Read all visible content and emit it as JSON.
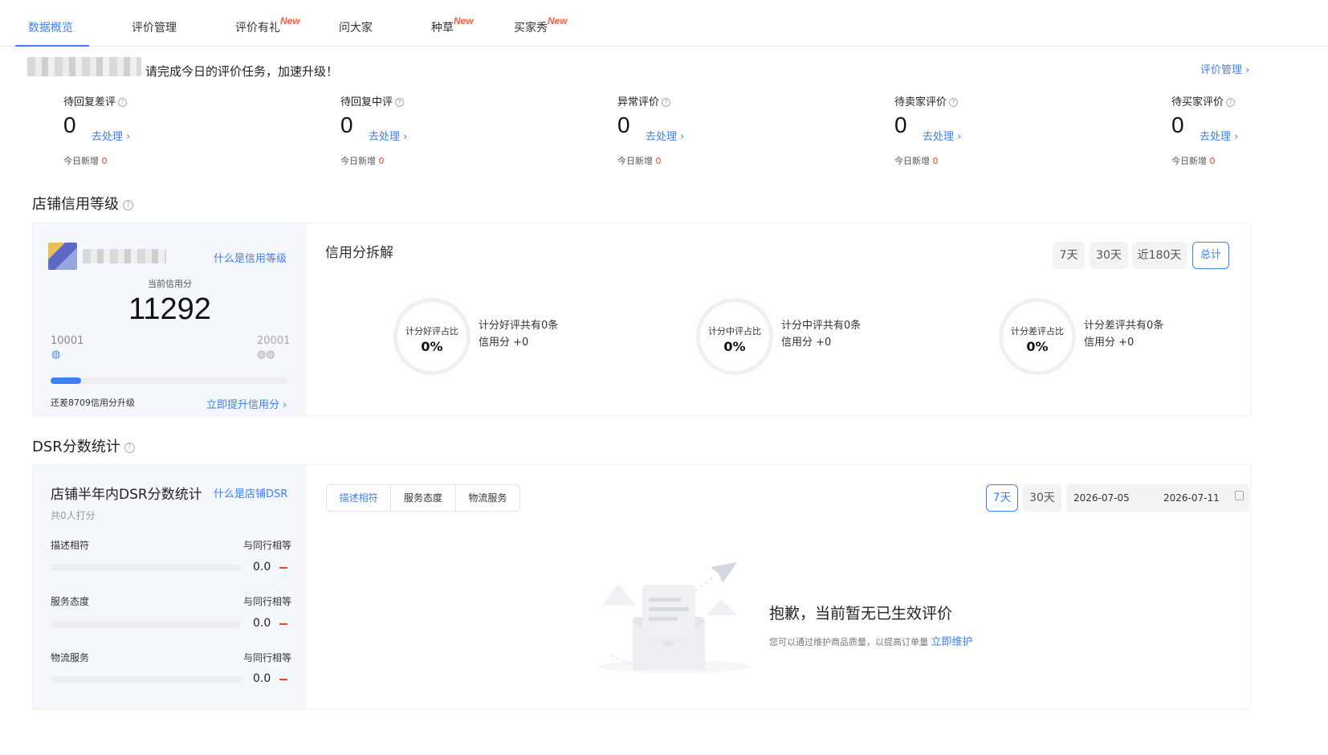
{
  "tabs": [
    {
      "label": "数据概览"
    },
    {
      "label": "评价管理"
    },
    {
      "label": "评价有礼",
      "badge": "New"
    },
    {
      "label": "问大家"
    },
    {
      "label": "种草",
      "badge": "New"
    },
    {
      "label": "买家秀",
      "badge": "New"
    }
  ],
  "notice": {
    "text": "请完成今日的评价任务，加速升级！",
    "manage_link": "评价管理 ›"
  },
  "stats": [
    {
      "title": "待回复差评",
      "value": "0",
      "action": "去处理 ›",
      "today_label": "今日新增",
      "today_value": "0"
    },
    {
      "title": "待回复中评",
      "value": "0",
      "action": "去处理 ›",
      "today_label": "今日新增",
      "today_value": "0"
    },
    {
      "title": "异常评价",
      "value": "0",
      "action": "去处理 ›",
      "today_label": "今日新增",
      "today_value": "0"
    },
    {
      "title": "待卖家评价",
      "value": "0",
      "action": "去处理 ›",
      "today_label": "今日新增",
      "today_value": "0"
    },
    {
      "title": "待买家评价",
      "value": "0",
      "action": "去处理 ›",
      "today_label": "今日新增",
      "today_value": "0"
    }
  ],
  "credit": {
    "section_title": "店铺信用等级",
    "what_link": "什么是信用等级",
    "current_label": "当前信用分",
    "score": "11292",
    "min_label": "10001",
    "max_label": "20001",
    "progress": 0.13,
    "remaining_text": "还差8709信用分升级",
    "improve_link": "立即提升信用分 ›",
    "breakdown_title": "信用分拆解",
    "periods": [
      "7天",
      "30天",
      "近180天",
      "总计"
    ],
    "active_period": "总计",
    "rings": [
      {
        "label": "计分好评占比",
        "percent": "0%",
        "line1": "计分好评共有0条",
        "line2": "信用分 +0"
      },
      {
        "label": "计分中评占比",
        "percent": "0%",
        "line1": "计分中评共有0条",
        "line2": "信用分 +0"
      },
      {
        "label": "计分差评占比",
        "percent": "0%",
        "line1": "计分差评共有0条",
        "line2": "信用分 +0"
      }
    ]
  },
  "dsr": {
    "section_title": "DSR分数统计",
    "panel_title": "店铺半年内DSR分数统计",
    "what_link": "什么是店铺DSR",
    "raters": "共0人打分",
    "rows": [
      {
        "label": "描述相符",
        "compare": "与同行相等",
        "value": "0.0"
      },
      {
        "label": "服务态度",
        "compare": "与同行相等",
        "value": "0.0"
      },
      {
        "label": "物流服务",
        "compare": "与同行相等",
        "value": "0.0"
      }
    ],
    "subtabs": [
      "描述相符",
      "服务态度",
      "物流服务"
    ],
    "active_subtab": "描述相符",
    "periods": [
      "7天",
      "30天"
    ],
    "active_period": "7天",
    "date_start": "2026-07-05",
    "date_end": "2026-07-11",
    "empty_title": "抱歉，当前暂无已生效评价",
    "empty_desc": "您可以通过维护商品质量，以提高订单量",
    "empty_link": "立即维护"
  },
  "colors": {
    "accent": "#3d7ff5",
    "badge": "#ff5a3c",
    "negative": "#f04134"
  }
}
